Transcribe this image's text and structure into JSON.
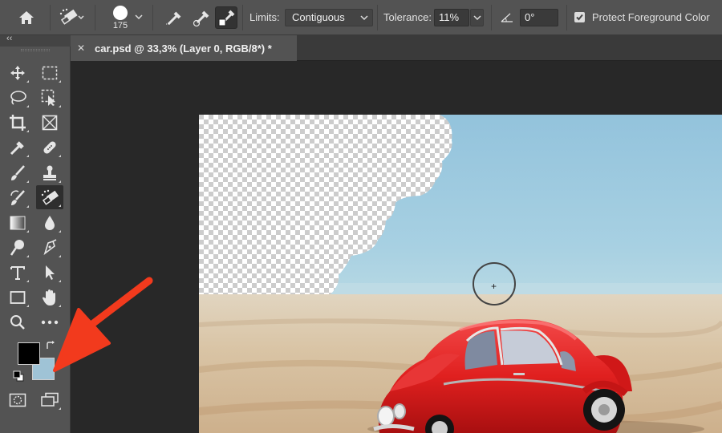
{
  "options_bar": {
    "brush_size": "175",
    "limits_label": "Limits:",
    "limits_value": "Contiguous",
    "tolerance_label": "Tolerance:",
    "tolerance_value": "11%",
    "angle_value": "0°",
    "protect_fg_label": "Protect Foreground Color",
    "protect_fg_checked": true
  },
  "document": {
    "tab_title": "car.psd @ 33,3% (Layer 0, RGB/8*) *",
    "tab_close": "✕"
  },
  "toolbar": {
    "collapse_glyph": "‹‹",
    "foreground_color": "#000000",
    "background_color": "#9fc3d6",
    "active_tool": "background-eraser-tool"
  },
  "annotation": {
    "arrow_color": "#f23a1d"
  },
  "canvas": {
    "brush_crosshair": "+"
  }
}
